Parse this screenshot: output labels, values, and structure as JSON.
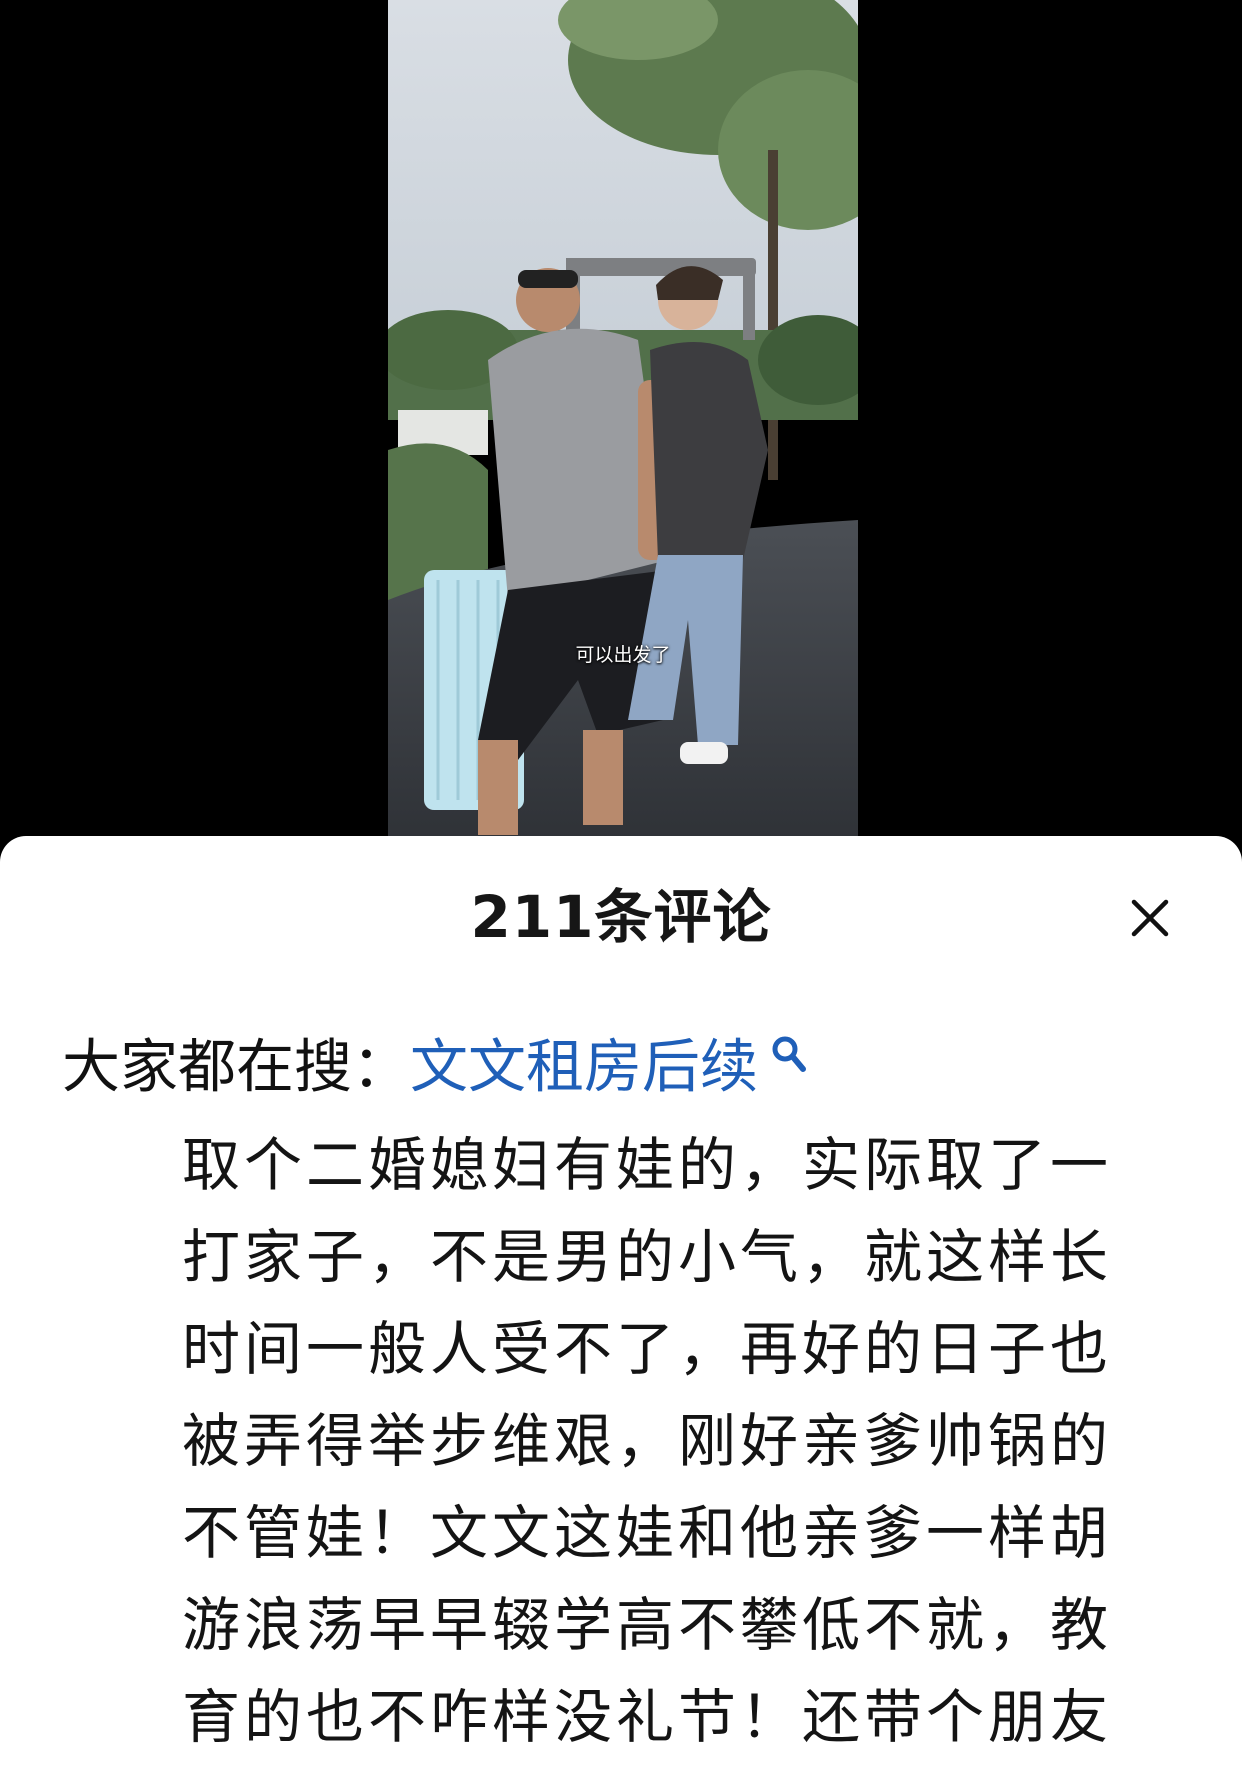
{
  "video": {
    "caption": "可以出发了"
  },
  "comments_panel": {
    "title": "211条评论",
    "close_icon": "close-icon",
    "search_prefix": "大家都在搜：",
    "search_term": "文文租房后续",
    "search_icon": "search-icon",
    "comment_text": "取个二婚媳妇有娃的，实际取了一打家子，不是男的小气，就这样长时间一般人受不了，再好的日子也被弄得举步维艰，刚好亲爹帅锅的不管娃！文文这娃和他亲爹一样胡游浪荡早早辍学高不攀低不就，教育的也不咋样没礼节！还带个朋友"
  },
  "colors": {
    "link_blue": "#1f5fb8",
    "sheet_bg": "#ffffff",
    "backdrop": "#000000"
  }
}
